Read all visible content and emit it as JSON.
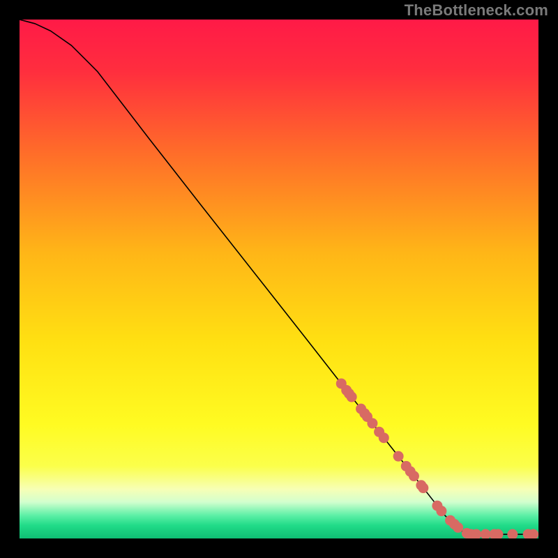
{
  "watermark": "TheBottleneck.com",
  "chart_data": {
    "type": "line",
    "title": "",
    "xlabel": "",
    "ylabel": "",
    "xlim": [
      0,
      100
    ],
    "ylim": [
      0,
      100
    ],
    "gradient_stops": [
      {
        "offset": 0.0,
        "color": "#ff1a47"
      },
      {
        "offset": 0.1,
        "color": "#ff2e3e"
      },
      {
        "offset": 0.25,
        "color": "#ff6a2a"
      },
      {
        "offset": 0.45,
        "color": "#ffb617"
      },
      {
        "offset": 0.62,
        "color": "#ffe012"
      },
      {
        "offset": 0.78,
        "color": "#fffb22"
      },
      {
        "offset": 0.86,
        "color": "#fbff4a"
      },
      {
        "offset": 0.905,
        "color": "#f7ffb5"
      },
      {
        "offset": 0.93,
        "color": "#d2ffce"
      },
      {
        "offset": 0.955,
        "color": "#5ff0a7"
      },
      {
        "offset": 0.975,
        "color": "#20db88"
      },
      {
        "offset": 1.0,
        "color": "#0fbf74"
      }
    ],
    "curve": [
      {
        "x": 0.0,
        "y": 100.0
      },
      {
        "x": 3.0,
        "y": 99.2
      },
      {
        "x": 6.0,
        "y": 97.8
      },
      {
        "x": 10.0,
        "y": 95.0
      },
      {
        "x": 15.0,
        "y": 90.0
      },
      {
        "x": 20.0,
        "y": 83.5
      },
      {
        "x": 25.0,
        "y": 77.0
      },
      {
        "x": 35.0,
        "y": 64.2
      },
      {
        "x": 45.0,
        "y": 51.5
      },
      {
        "x": 55.0,
        "y": 38.8
      },
      {
        "x": 65.0,
        "y": 26.0
      },
      {
        "x": 75.0,
        "y": 13.3
      },
      {
        "x": 82.0,
        "y": 4.4
      },
      {
        "x": 85.5,
        "y": 1.2
      },
      {
        "x": 87.0,
        "y": 0.8
      },
      {
        "x": 100.0,
        "y": 0.8
      }
    ],
    "markers": {
      "color": "#d86a63",
      "x": [
        62.0,
        63.0,
        63.5,
        64.0,
        65.8,
        66.5,
        67.0,
        68.0,
        69.3,
        70.2,
        73.0,
        74.5,
        75.3,
        76.0,
        77.4,
        77.8,
        80.5,
        81.3,
        83.0,
        83.8,
        84.5,
        86.2,
        87.0,
        88.0,
        89.8,
        91.5,
        92.2,
        95.0,
        98.0,
        99.0
      ]
    }
  }
}
